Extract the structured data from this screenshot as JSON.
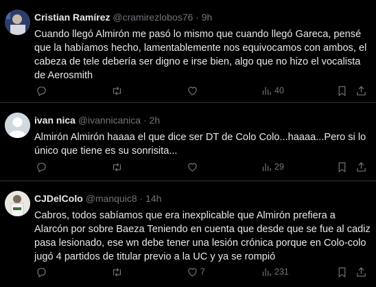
{
  "tweets": [
    {
      "name": "Cristian Ramírez",
      "handle": "@cramirezlobos76",
      "sep": "·",
      "time": "9h",
      "text": "Cuando llegó Almirón me pasó lo mismo que cuando llegó Gareca, pensé que la habíamos hecho, lamentablemente nos equivocamos con ambos, el cabeza de tele debería ser digno e irse bien, algo que no hizo el vocalista de Aerosmith",
      "replies": "",
      "retweets": "",
      "likes": "",
      "views": "40"
    },
    {
      "name": "ivan nica",
      "handle": "@ivannicanica",
      "sep": "·",
      "time": "2h",
      "text": "Almirón Almirón haaaa el que dice ser DT de Colo Colo...haaaa...Pero si lo único que tiene es su sonrisita...",
      "replies": "",
      "retweets": "",
      "likes": "",
      "views": "29"
    },
    {
      "name": "CJDelColo",
      "handle": "@manquic8",
      "sep": "·",
      "time": "14h",
      "text": "Cabros, todos sabíamos que era inexplicable que Almirón prefiera a Alarcón por sobre Baeza Teniendo en cuenta que desde que se fue al cadiz pasa lesionado, ese wn debe tener una lesión crónica porque en Colo-colo jugó 4 partidos de titular previo a la UC y ya se rompió",
      "replies": "",
      "retweets": "",
      "likes": "7",
      "views": "231"
    }
  ],
  "icons": [
    "reply-icon",
    "retweet-icon",
    "like-icon",
    "views-icon",
    "bookmark-icon",
    "share-icon"
  ],
  "colors": {
    "background": "#000000",
    "text": "#e7e9ea",
    "muted": "#71767b",
    "divider": "#2f3336"
  }
}
